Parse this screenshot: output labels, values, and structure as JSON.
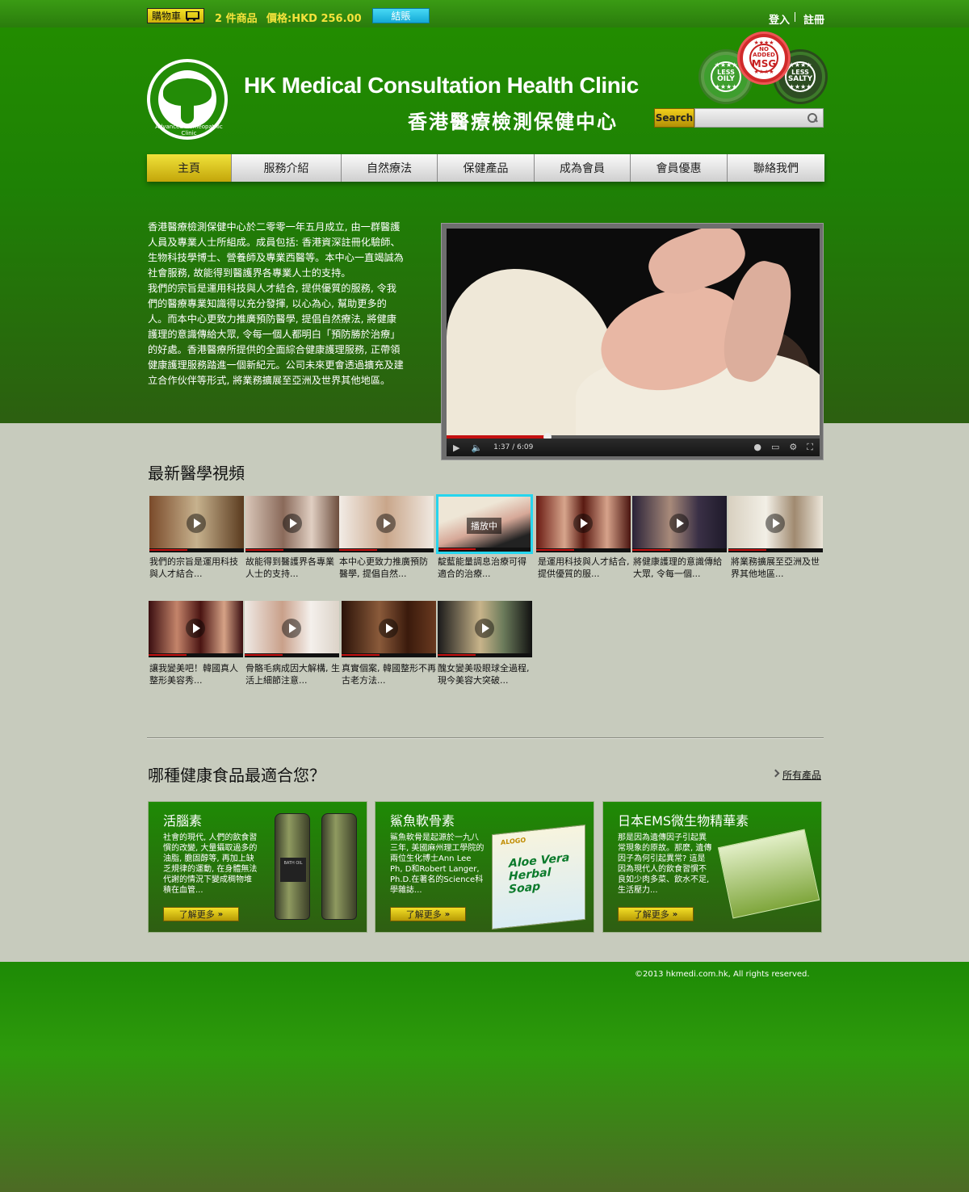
{
  "topbar": {
    "cart_label": "購物車",
    "cart_count": "2 件商品",
    "cart_price": "價格:HKD 256.00",
    "checkout": "結賬",
    "login": "登入",
    "register": "註冊"
  },
  "header": {
    "title_en": "HK Medical Consultation Health Clinic",
    "title_zh": "香港醫療檢測保健中心",
    "logo_text": "Advanced Homeopathic Clinic",
    "badges": [
      {
        "top": "★★★★",
        "main": "OILY",
        "sub": "LESS",
        "bottom": "★★★★"
      },
      {
        "top": "★★★★",
        "main": "MSG",
        "sub": "NO ADDED",
        "bottom": "★★★★"
      },
      {
        "top": "★★★★",
        "main": "SALTY",
        "sub": "LESS",
        "bottom": "★★★★"
      }
    ],
    "search_label": "Search",
    "search_placeholder": ""
  },
  "nav": {
    "items": [
      "主頁",
      "服務介紹",
      "自然療法",
      "保健產品",
      "成為會員",
      "會員優惠",
      "聯絡我們"
    ]
  },
  "intro": {
    "paragraphs": [
      "香港醫療檢測保健中心於二零零一年五月成立, 由一群醫護人員及專業人士所組成。成員包括: 香港資深註冊化驗師、生物科技學博士、營養師及專業西醫等。本中心一直竭誠為社會服務, 故能得到醫護界各專業人士的支持。",
      "我們的宗旨是運用科技與人才結合, 提供優質的服務, 令我們的醫療專業知識得以充分發揮, 以心為心, 幫助更多的人。而本中心更致力推廣預防醫學, 提倡自然療法, 將健康護理的意識傳給大眾, 令每一個人都明白「預防勝於治療」的好處。香港醫療所提供的全面綜合健康護理服務, 正帶領健康護理服務踏進一個新紀元。公司未來更會透過擴充及建立合作伙伴等形式, 將業務擴展至亞洲及世界其他地區。"
    ]
  },
  "video": {
    "time": "1:37 / 6:09",
    "progress": 0.27
  },
  "videos_section": {
    "title": "最新醫學視頻",
    "playing_label": "播放中",
    "items": [
      {
        "caption": "我們的宗旨是運用科技與人才結合..."
      },
      {
        "caption": "故能得到醫護界各專業人士的支持..."
      },
      {
        "caption": "本中心更致力推廣預防醫學, 提倡自然..."
      },
      {
        "caption": "靛藍能量調息治療可得適合的治療..."
      },
      {
        "caption": "是運用科技與人才結合, 提供優質的服..."
      },
      {
        "caption": "將健康護理的意識傳給大眾, 令每一個..."
      },
      {
        "caption": "將業務擴展至亞洲及世界其他地區..."
      },
      {
        "caption": "讓我變美吧！韓國真人整形美容秀..."
      },
      {
        "caption": "骨骼毛病成因大解構, 生活上細節注意..."
      },
      {
        "caption": "真實個案, 韓國整形不再古老方法..."
      },
      {
        "caption": "醜女變美吸眼球全過程, 現今美容大突破..."
      }
    ]
  },
  "products_section": {
    "title": "哪種健康食品最適合您？",
    "all_products": "所有產品",
    "items": [
      {
        "title": "活腦素",
        "desc": "社會的現代, 人們的飲食習慣的改變, 大量攝取過多的油脂, 膽固醇等, 再加上缺乏規律的運動, 在身體無法代謝的情況下變成稠物堆積在血管...",
        "button": "了解更多"
      },
      {
        "title": "鯊魚軟骨素",
        "desc": "鯊魚軟骨是起源於一九八三年, 美國麻州理工學院的兩位生化博士Ann Lee Ph, D和Robert Langer, Ph.D.在著名的Science科學雜誌...",
        "button": "了解更多"
      },
      {
        "title": "日本EMS微生物精華素",
        "desc": "那是因為遺傳因子引起異常現象的原故。那麼, 遺傳因子為何引起異常? 這是因為現代人的飲食習慣不良如少肉多菜、飲水不足, 生活壓力...",
        "button": "了解更多"
      }
    ],
    "bottle_label": "BATH OIL",
    "soap_brand": "ALOGO",
    "soap_title": "Aloe Vera Herbal Soap"
  },
  "footer": {
    "copyright": "©2013 hkmedi.com.hk, All rights reserved."
  }
}
